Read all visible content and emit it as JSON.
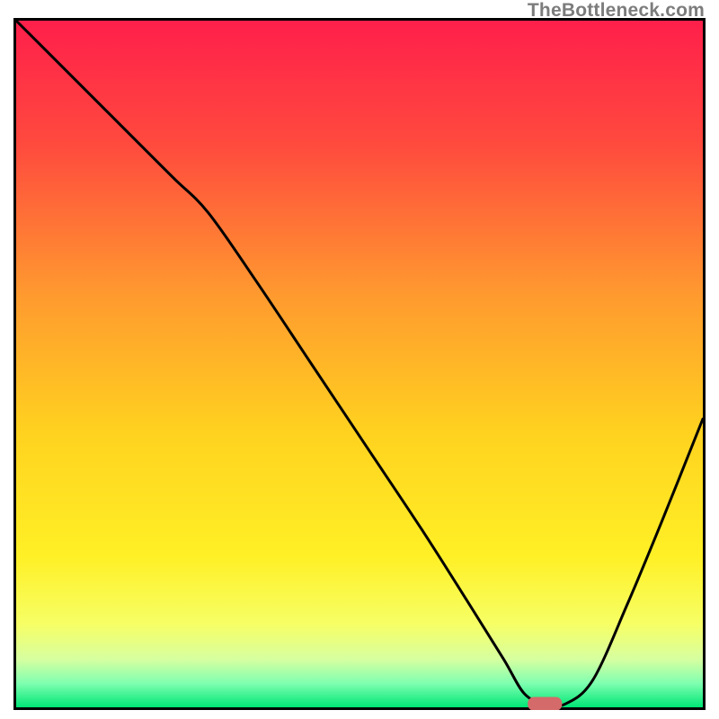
{
  "watermark": "TheBottleneck.com",
  "chart_data": {
    "type": "line",
    "title": "",
    "xlabel": "",
    "ylabel": "",
    "xlim": [
      0,
      100
    ],
    "ylim": [
      0,
      100
    ],
    "grid": false,
    "legend": null,
    "gradient_background": {
      "stops": [
        {
          "offset": 0.0,
          "color": "#ff1f4b"
        },
        {
          "offset": 0.18,
          "color": "#ff4a3e"
        },
        {
          "offset": 0.4,
          "color": "#ff9a2f"
        },
        {
          "offset": 0.6,
          "color": "#ffd21f"
        },
        {
          "offset": 0.78,
          "color": "#fff026"
        },
        {
          "offset": 0.88,
          "color": "#f6ff66"
        },
        {
          "offset": 0.93,
          "color": "#d7ffa0"
        },
        {
          "offset": 0.965,
          "color": "#7fffb0"
        },
        {
          "offset": 1.0,
          "color": "#00e676"
        }
      ]
    },
    "series": [
      {
        "name": "bottleneck-curve",
        "color": "#000000",
        "x": [
          0,
          6,
          12,
          18,
          23,
          28,
          35,
          43,
          51,
          59,
          66,
          71,
          74,
          77,
          80,
          84,
          89,
          94,
          100
        ],
        "y": [
          100,
          94,
          88,
          82,
          77,
          72,
          62,
          50,
          38,
          26,
          15,
          7,
          2,
          0.5,
          0.5,
          4,
          15,
          27,
          42
        ]
      }
    ],
    "marker": {
      "name": "optimal-range-marker",
      "shape": "rounded-rect",
      "color": "#d46a6a",
      "x_center": 77,
      "y": 0.5,
      "width_x_units": 5,
      "height_y_units": 2
    },
    "notes": "y-values eyeballed as percent of plot height from top of green baseline; curve starts at top-left corner (0,100), has a slight slope break near x≈23, reaches a flat minimum around x≈74–80 at y≈0, then rises to roughly y≈42 at x=100."
  }
}
